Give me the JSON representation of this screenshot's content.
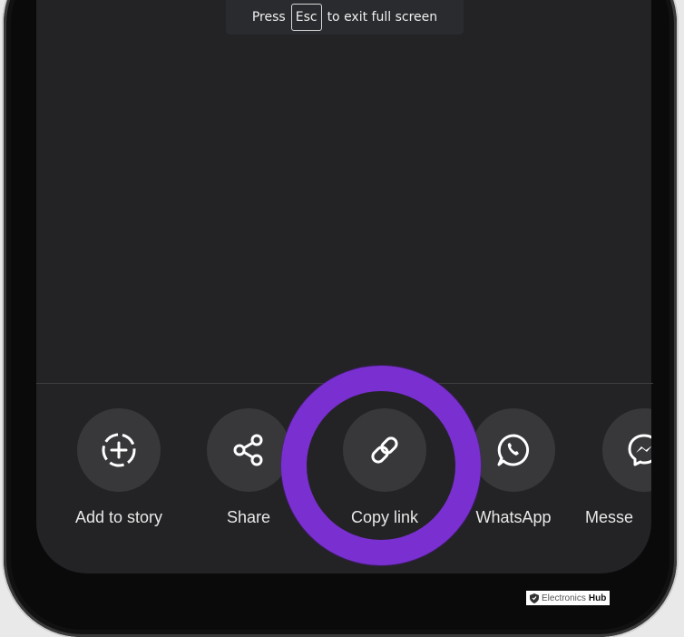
{
  "fullscreen_banner": {
    "prefix": "Press",
    "key": "Esc",
    "suffix": "to exit full screen"
  },
  "share_sheet": {
    "items": [
      {
        "label": "Add to story",
        "icon": "add-story-icon"
      },
      {
        "label": "Share",
        "icon": "share-icon"
      },
      {
        "label": "Copy link",
        "icon": "link-icon"
      },
      {
        "label": "WhatsApp",
        "icon": "whatsapp-icon"
      },
      {
        "label": "Messe",
        "icon": "messenger-icon"
      }
    ]
  },
  "highlight": {
    "target": "Copy link",
    "color": "#7a2fd0"
  },
  "watermark": {
    "brand": "Electronics",
    "brand_bold": "Hub"
  },
  "colors": {
    "screen_bg": "#232325",
    "icon_circle": "#38383b",
    "text": "#e8e8e8"
  }
}
